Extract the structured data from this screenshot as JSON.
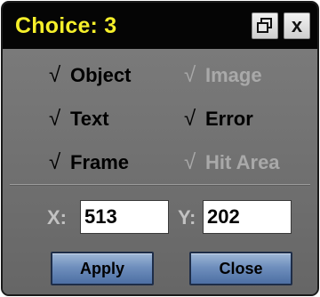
{
  "window": {
    "title": "Choice: 3",
    "restore_icon": "restore-window-icon",
    "close_label": "x"
  },
  "options": [
    {
      "label": "Object",
      "checked": true,
      "enabled": true
    },
    {
      "label": "Image",
      "checked": true,
      "enabled": false
    },
    {
      "label": "Text",
      "checked": true,
      "enabled": true
    },
    {
      "label": "Error",
      "checked": true,
      "enabled": true
    },
    {
      "label": "Frame",
      "checked": true,
      "enabled": true
    },
    {
      "label": "Hit Area",
      "checked": true,
      "enabled": false
    }
  ],
  "checkmark": "√",
  "coords": {
    "x_label": "X:",
    "x_value": "513",
    "y_label": "Y:",
    "y_value": "202"
  },
  "buttons": {
    "apply": "Apply",
    "close": "Close"
  },
  "colors": {
    "title_text": "#f5ef2a",
    "titlebar_bg": "#050505",
    "panel_bg": "#6f6f6f",
    "disabled_text": "#a9a9a9",
    "button_blue": "#6f8fbd"
  }
}
